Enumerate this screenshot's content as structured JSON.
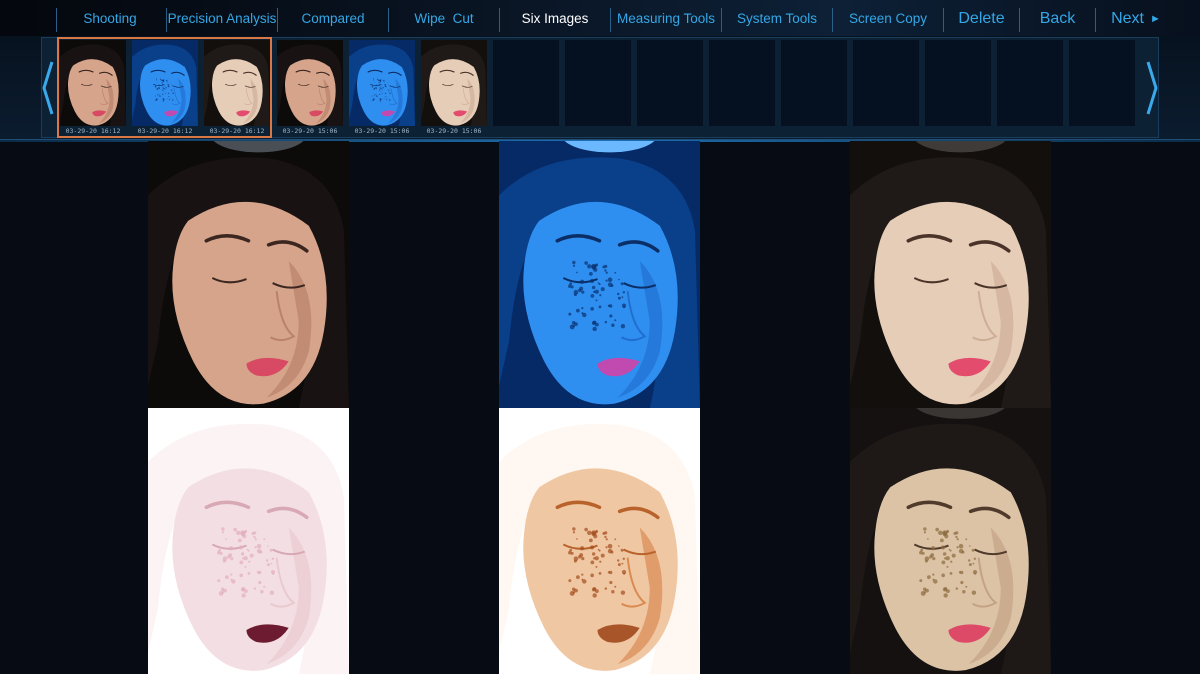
{
  "toolbar": {
    "shooting": "Shooting",
    "precision_analysis": "Precision Analysis",
    "compared": "Compared",
    "wipe_cut": "Wipe  Cut",
    "six_images": "Six Images",
    "measuring_tools": "Measuring Tools",
    "system_tools": "System Tools",
    "screen_copy": "Screen Copy",
    "delete": "Delete",
    "back": "Back",
    "next": "Next",
    "active_item": "Six Images"
  },
  "thumbnails": [
    {
      "mode": "natural",
      "timestamp": "03-29-20 16:12",
      "selected": true
    },
    {
      "mode": "uv",
      "timestamp": "03-29-20 16:12",
      "selected": true
    },
    {
      "mode": "polarized",
      "timestamp": "03-29-20 16:12",
      "selected": true
    },
    {
      "mode": "natural",
      "timestamp": "03-29-20 15:06",
      "selected": false
    },
    {
      "mode": "uv",
      "timestamp": "03-29-20 15:06",
      "selected": false
    },
    {
      "mode": "polarized",
      "timestamp": "03-29-20 15:06",
      "selected": false
    }
  ],
  "panels": [
    {
      "mode": "natural"
    },
    {
      "mode": "uv"
    },
    {
      "mode": "polarized"
    },
    {
      "mode": "redness-map"
    },
    {
      "mode": "brown-spot-map"
    },
    {
      "mode": "pigmentation"
    }
  ],
  "colors": {
    "accent": "#34a7e6",
    "active_text": "#ffffff",
    "selection_border": "#d97844",
    "background": "#070b14"
  },
  "icons": [
    "chevron-left-icon",
    "chevron-right-icon",
    "play-arrow-icon"
  ]
}
